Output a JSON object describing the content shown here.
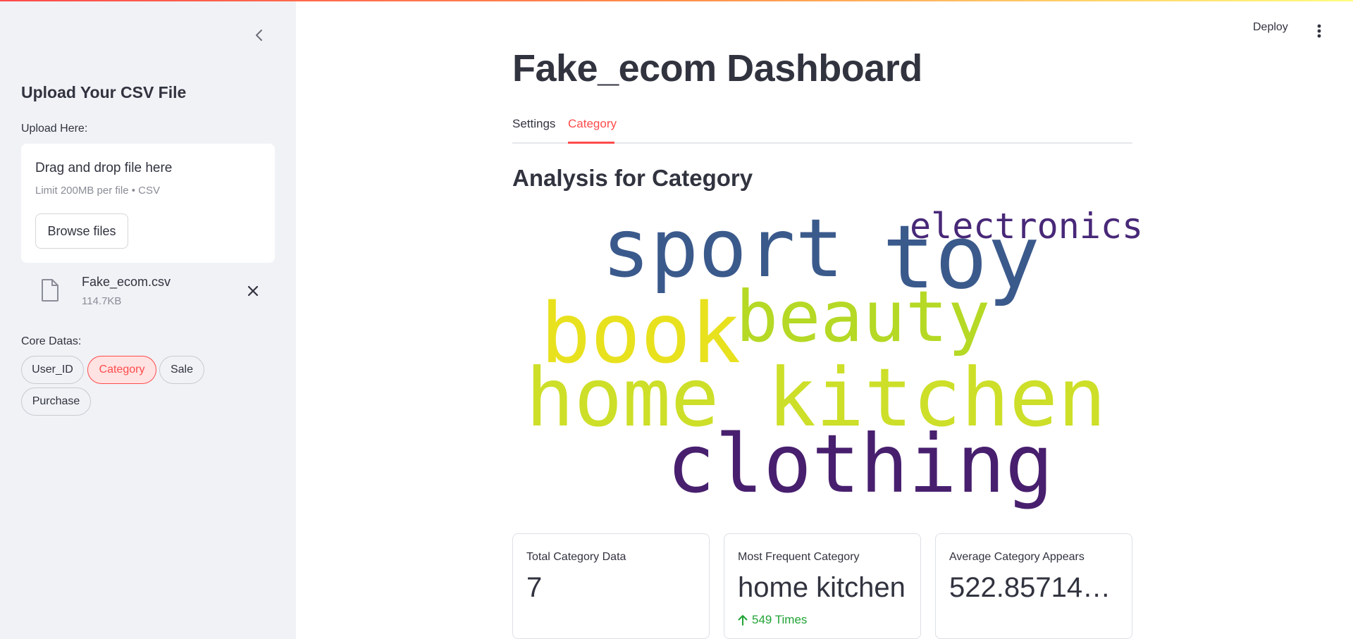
{
  "app": {
    "deploy_label": "Deploy"
  },
  "sidebar": {
    "title": "Upload Your CSV File",
    "upload_label": "Upload Here:",
    "dropzone": {
      "main_text": "Drag and drop file here",
      "sub_text": "Limit 200MB per file • CSV",
      "browse_label": "Browse files"
    },
    "file": {
      "name": "Fake_ecom.csv",
      "size": "114.7KB"
    },
    "core_label": "Core Datas:",
    "pills": [
      "User_ID",
      "Category",
      "Sale",
      "Purchase"
    ],
    "active_pill": "Category"
  },
  "main": {
    "title": "Fake_ecom Dashboard",
    "tabs": [
      "Settings",
      "Category"
    ],
    "active_tab": "Category",
    "section_title": "Analysis for Category",
    "wordcloud": [
      {
        "text": "sport",
        "color": "#3b5a8c"
      },
      {
        "text": "toy",
        "color": "#3b5a8c"
      },
      {
        "text": "electronics",
        "color": "#482878"
      },
      {
        "text": "book",
        "color": "#e8e11e"
      },
      {
        "text": "beauty",
        "color": "#b5d925"
      },
      {
        "text": "home kitchen",
        "color": "#cddf28"
      },
      {
        "text": "clothing",
        "color": "#481f6e"
      }
    ],
    "metrics": [
      {
        "label": "Total Category Data",
        "value": "7",
        "delta": ""
      },
      {
        "label": "Most Frequent Category",
        "value": "home kitchen",
        "delta": "549 Times"
      },
      {
        "label": "Average Category Appears",
        "value": "522.857142857",
        "delta": ""
      }
    ]
  },
  "colors": {
    "accent": "#ff4b4b",
    "positive": "#21a336",
    "sidebar_bg": "#f0f2f6"
  }
}
